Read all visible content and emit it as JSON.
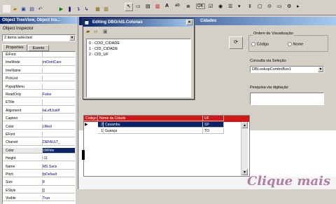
{
  "colors": {
    "highlight": "#0a246a",
    "grid_red": "#d01818",
    "window_face": "#d4d0c8",
    "watermark": "#7a1f5c"
  },
  "toolbar": {
    "icons": [
      "new-icon",
      "open-icon",
      "save-icon",
      "save-all-icon",
      "undo-icon",
      "run-icon",
      "pause-icon",
      "step-icon",
      "trace-icon",
      "form-icon",
      "unit-icon",
      "toggle-icon",
      "help-icon"
    ]
  },
  "object_treeview": {
    "title": "Object TreeView, Object Ins..."
  },
  "object_inspector": {
    "title": "Object Inspector",
    "selector_value": "2 items selected",
    "tabs": [
      "Properties",
      "Events"
    ],
    "rows": [
      {
        "key": "EiFont",
        "value": ""
      },
      {
        "key": "ImeMode",
        "value": "imDontCare"
      },
      {
        "key": "ImeName",
        "value": ""
      },
      {
        "key": "PickList",
        "value": ""
      },
      {
        "key": "PopupMenu",
        "value": ""
      },
      {
        "key": "ReadOnly",
        "value": "False"
      },
      {
        "key": "ETitle",
        "value": ""
      },
      {
        "key": "Alignment",
        "value": "taLeftJustif"
      },
      {
        "key": "Caption",
        "value": ""
      },
      {
        "key": "Color",
        "value": "clRed"
      },
      {
        "key": "EFont",
        "value": ""
      },
      {
        "key": "Charset",
        "value": "DEFAULT_"
      },
      {
        "key": "Color",
        "value": "clWhite"
      },
      {
        "key": "Height",
        "value": "-11"
      },
      {
        "key": "Name",
        "value": "MS Sans"
      },
      {
        "key": "Pitch",
        "value": "fpDefault"
      },
      {
        "key": "Size",
        "value": "8"
      },
      {
        "key": "EStyle",
        "value": "[]"
      },
      {
        "key": "Visible",
        "value": "True"
      }
    ]
  },
  "editor_dialog": {
    "title": "Editing DBGrid1.Colunas",
    "items": [
      "0 - COD_CIDADE",
      "1 - CID_CIDADE",
      "2 - CID_UF"
    ]
  },
  "form": {
    "title": "Cidades",
    "ordem": {
      "label": "Ordem de Visualização",
      "options": [
        "Código",
        "Nome"
      ]
    },
    "consulta": {
      "label": "Consulta via Seleção",
      "value": "DBLookupComboBox1"
    },
    "pesquisa": {
      "label": "Pesquisa via digitação"
    },
    "grid": {
      "headers": [
        "Código",
        "Nome da Cidade",
        "UF"
      ],
      "rows": [
        {
          "code": "2",
          "name": "Caxambu",
          "uf": "SP"
        },
        {
          "code": "1",
          "name": "Guaiuja",
          "uf": "TO"
        }
      ]
    }
  },
  "watermark": {
    "text": "Clique mais"
  }
}
